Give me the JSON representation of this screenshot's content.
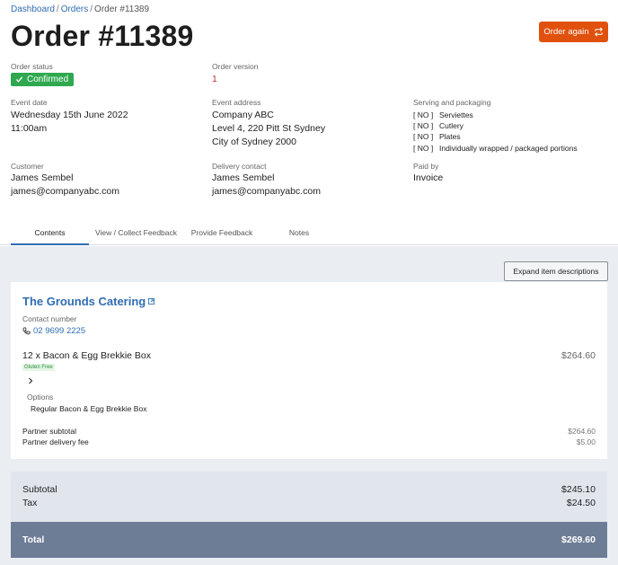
{
  "breadcrumb": {
    "items": [
      "Dashboard",
      "Orders"
    ],
    "current": "Order #11389"
  },
  "page_title": "Order #11389",
  "order_again_label": "Order again",
  "order_status": {
    "label": "Order status",
    "value": "Confirmed"
  },
  "order_version": {
    "label": "Order version",
    "value": "1"
  },
  "event_date": {
    "label": "Event date",
    "date": "Wednesday 15th June 2022",
    "time": "11:00am"
  },
  "event_address": {
    "label": "Event address",
    "lines": [
      "Company ABC",
      "Level 4, 220 Pitt St Sydney",
      "City of Sydney 2000"
    ]
  },
  "serving": {
    "label": "Serving and packaging",
    "items": [
      {
        "flag": "[ NO ]",
        "name": "Serviettes"
      },
      {
        "flag": "[ NO ]",
        "name": "Cutlery"
      },
      {
        "flag": "[ NO ]",
        "name": "Plates"
      },
      {
        "flag": "[ NO ]",
        "name": "Individually wrapped / packaged portions"
      }
    ]
  },
  "customer": {
    "label": "Customer",
    "name": "James Sembel",
    "email": "james@companyabc.com"
  },
  "delivery_contact": {
    "label": "Delivery contact",
    "name": "James Sembel",
    "email": "james@companyabc.com"
  },
  "paid_by": {
    "label": "Paid by",
    "value": "Invoice"
  },
  "tabs": [
    "Contents",
    "View / Collect Feedback",
    "Provide Feedback",
    "Notes"
  ],
  "active_tab": "Contents",
  "expand_button_label": "Expand item descriptions",
  "supplier": {
    "name": "The Grounds Catering",
    "contact_label": "Contact number",
    "phone": "02 9699 2225",
    "item": {
      "quantity_name": "12 x Bacon & Egg Brekkie Box",
      "price": "$264.60",
      "tag": "Gluten Free"
    },
    "options_label": "Options",
    "option_value": "Regular Bacon & Egg Brekkie Box",
    "partner_subtotal_label": "Partner subtotal",
    "partner_subtotal": "$264.60",
    "partner_delivery_label": "Partner delivery fee",
    "partner_delivery": "$5.00"
  },
  "totals": {
    "subtotal_label": "Subtotal",
    "subtotal": "$245.10",
    "tax_label": "Tax",
    "tax": "$24.50",
    "total_label": "Total",
    "total": "$269.60"
  },
  "colors": {
    "accent": "#2f6db3",
    "cta": "#e0510e",
    "status": "#2fa84f",
    "total_bar": "#6e7d96"
  }
}
